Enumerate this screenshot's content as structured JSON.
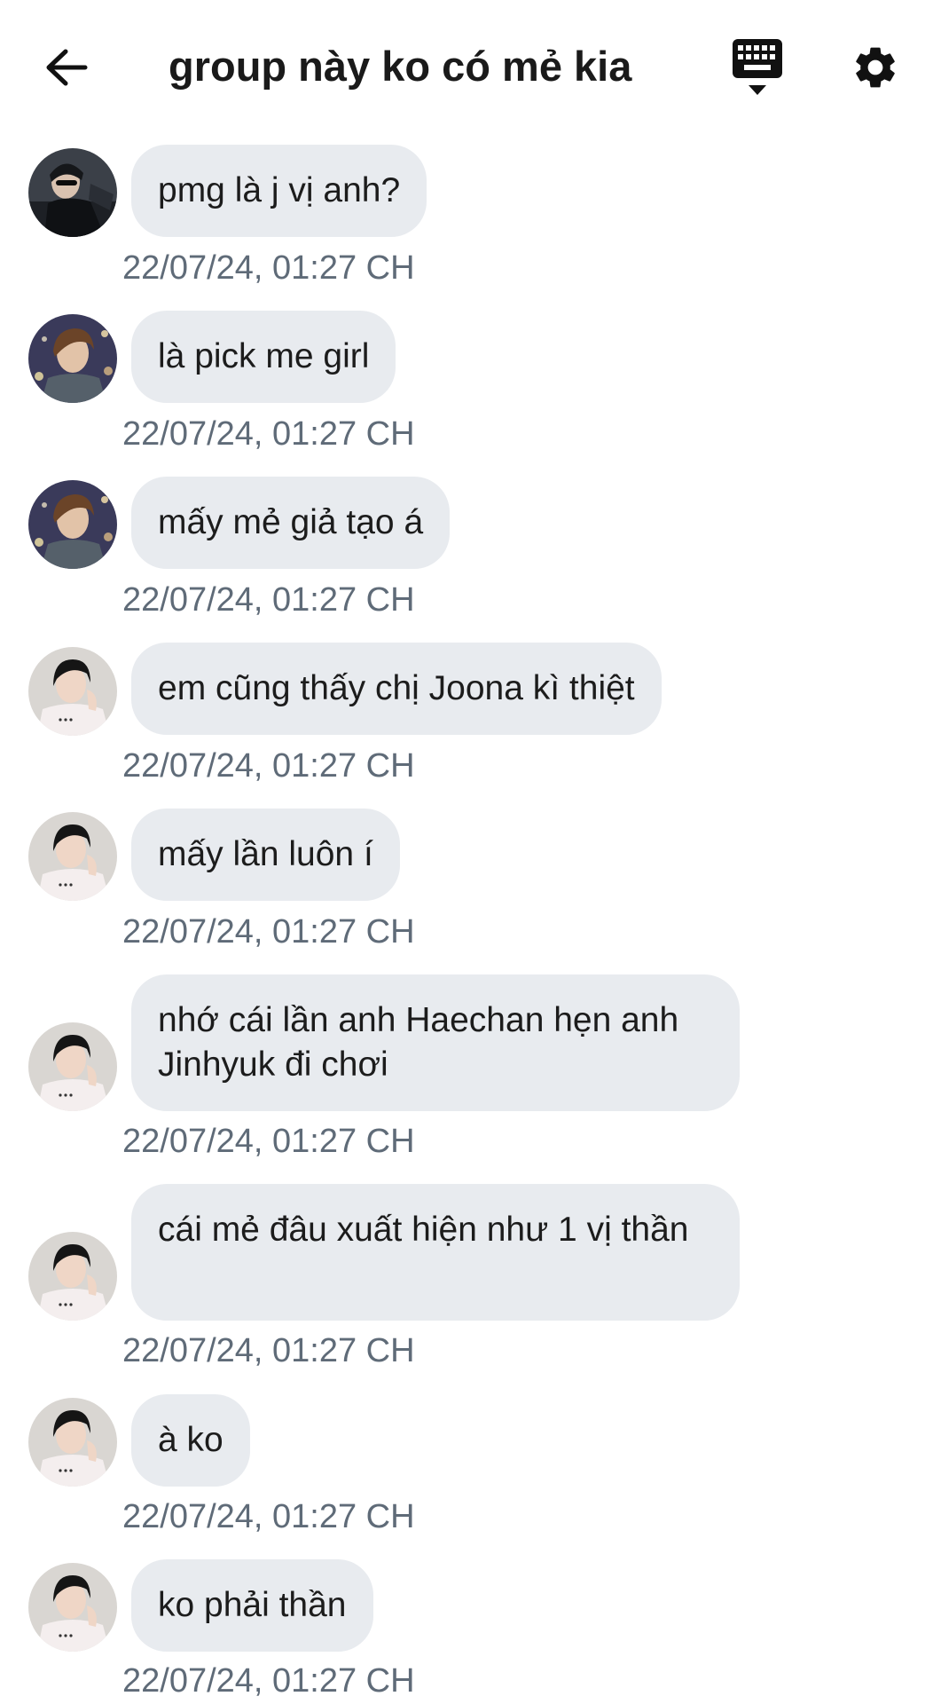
{
  "header": {
    "title": "group này ko có mẻ kia",
    "back_icon": "arrow-left-icon",
    "keyboard_icon": "keyboard-icon",
    "settings_icon": "gear-icon"
  },
  "messages": [
    {
      "sender_avatar": "avatar-dark-jacket",
      "text": "pmg là j vị anh?",
      "time": "22/07/24, 01:27 CH"
    },
    {
      "sender_avatar": "avatar-lights",
      "text": "là pick me girl",
      "time": "22/07/24, 01:27 CH"
    },
    {
      "sender_avatar": "avatar-lights",
      "text": "mấy mẻ giả tạo á",
      "time": "22/07/24, 01:27 CH"
    },
    {
      "sender_avatar": "avatar-white-shirt",
      "text": "em cũng thấy chị Joona kì thiệt",
      "time": "22/07/24, 01:27 CH"
    },
    {
      "sender_avatar": "avatar-white-shirt",
      "text": "mấy lần luôn í",
      "time": "22/07/24, 01:27 CH"
    },
    {
      "sender_avatar": "avatar-white-shirt",
      "text": "nhớ cái lần anh Haechan hẹn anh Jinhyuk đi chơi",
      "time": "22/07/24, 01:27 CH"
    },
    {
      "sender_avatar": "avatar-white-shirt",
      "text": "cái mẻ đâu xuất hiện như 1 vị thần",
      "time": "22/07/24, 01:27 CH"
    },
    {
      "sender_avatar": "avatar-white-shirt",
      "text": "à ko",
      "time": "22/07/24, 01:27 CH"
    },
    {
      "sender_avatar": "avatar-white-shirt",
      "text": "ko phải thần",
      "time": "22/07/24, 01:27 CH"
    }
  ],
  "colors": {
    "bubble": "#e8ebef",
    "timestamp": "#5f6b78",
    "title": "#1a1a1a"
  }
}
